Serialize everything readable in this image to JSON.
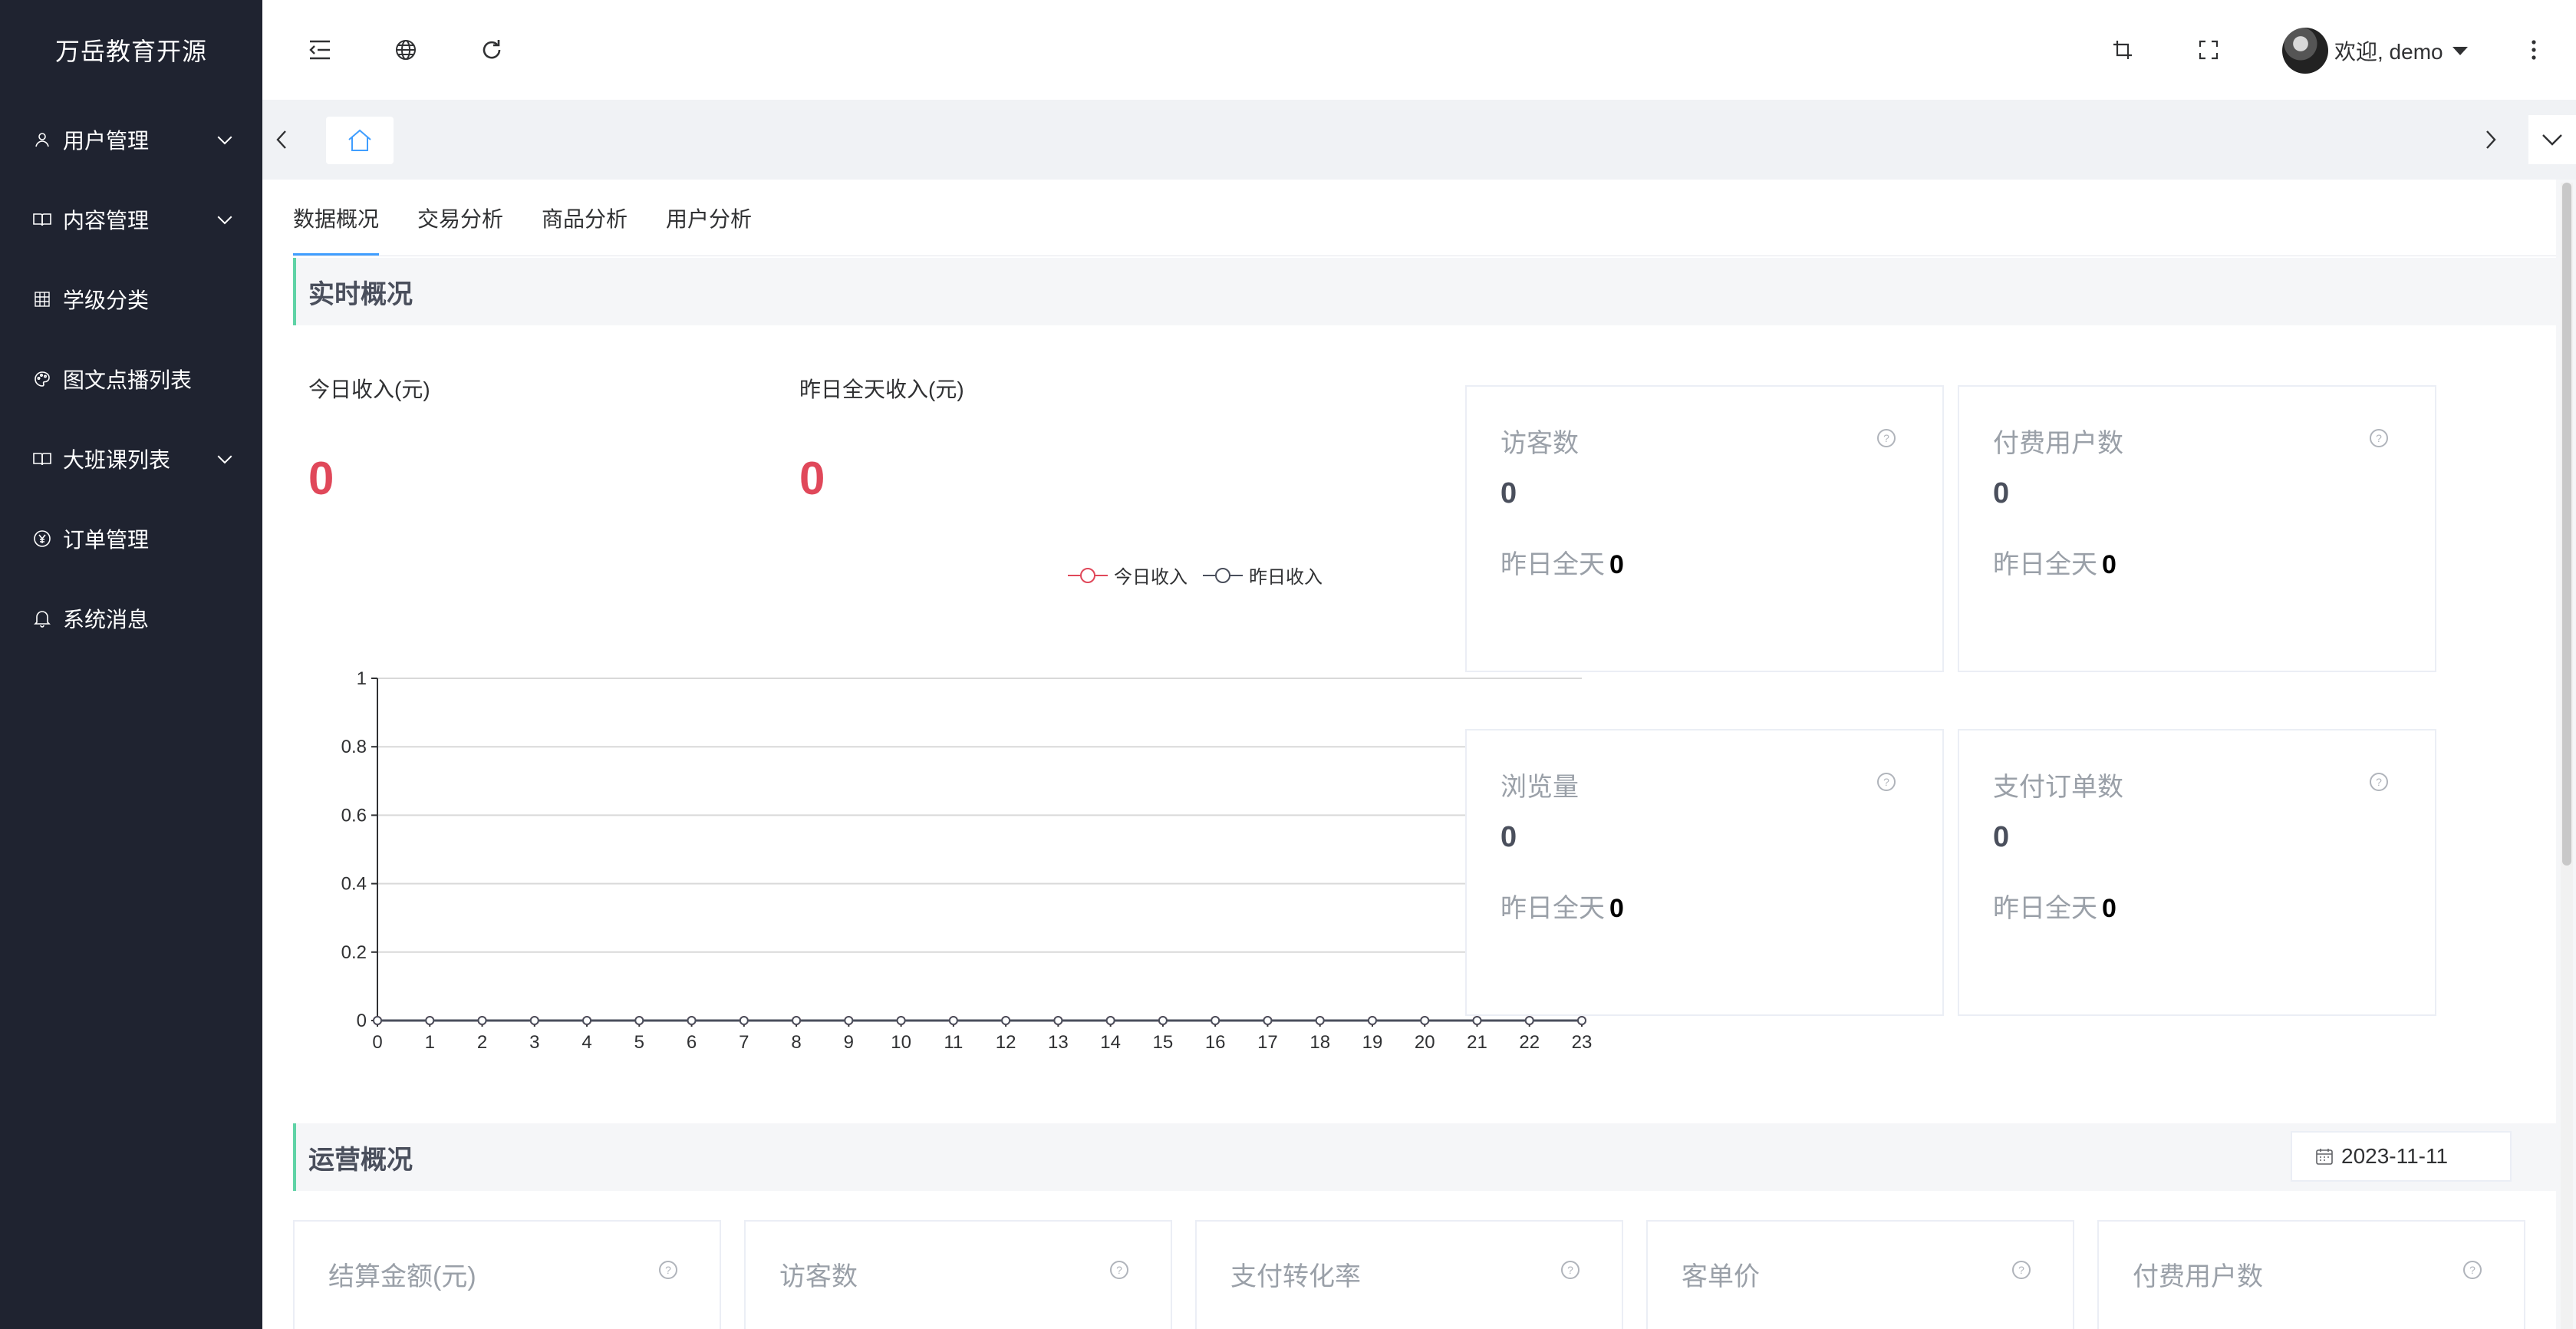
{
  "app": {
    "title": "万岳教育开源"
  },
  "sidebar": {
    "items": [
      {
        "label": "用户管理",
        "icon": "user-icon",
        "has_children": true
      },
      {
        "label": "内容管理",
        "icon": "book-icon",
        "has_children": true
      },
      {
        "label": "学级分类",
        "icon": "grid-icon",
        "has_children": false
      },
      {
        "label": "图文点播列表",
        "icon": "palette-icon",
        "has_children": false
      },
      {
        "label": "大班课列表",
        "icon": "book-icon",
        "has_children": true
      },
      {
        "label": "订单管理",
        "icon": "yen-icon",
        "has_children": false
      },
      {
        "label": "系统消息",
        "icon": "bell-icon",
        "has_children": false
      }
    ]
  },
  "header": {
    "icons": [
      "collapse-menu-icon",
      "globe-icon",
      "refresh-icon",
      "crop-icon",
      "fullscreen-icon",
      "more-vertical-icon"
    ],
    "user_name": "欢迎, demo"
  },
  "tabs": [
    {
      "label": "数据概况",
      "active": true
    },
    {
      "label": "交易分析",
      "active": false
    },
    {
      "label": "商品分析",
      "active": false
    },
    {
      "label": "用户分析",
      "active": false
    }
  ],
  "realtime": {
    "title": "实时概况",
    "today_label": "今日收入(元)",
    "today_value": "0",
    "yesterday_label": "昨日全天收入(元)",
    "yesterday_value": "0",
    "legend": [
      "今日收入",
      "昨日收入"
    ],
    "cards": [
      {
        "title": "访客数",
        "value": "0",
        "yest_label": "昨日全天",
        "yest_value": "0"
      },
      {
        "title": "付费用户数",
        "value": "0",
        "yest_label": "昨日全天",
        "yest_value": "0"
      },
      {
        "title": "浏览量",
        "value": "0",
        "yest_label": "昨日全天",
        "yest_value": "0"
      },
      {
        "title": "支付订单数",
        "value": "0",
        "yest_label": "昨日全天",
        "yest_value": "0"
      }
    ]
  },
  "operation": {
    "title": "运营概况",
    "date": "2023-11-11",
    "cards": [
      {
        "title": "结算金额(元)"
      },
      {
        "title": "访客数"
      },
      {
        "title": "支付转化率"
      },
      {
        "title": "客单价"
      },
      {
        "title": "付费用户数"
      }
    ]
  },
  "colors": {
    "sidebar_bg": "#1f2330",
    "accent": "#409eff",
    "revenue": "#e0485a",
    "section_border": "#5fd3a6",
    "today_series": "#e0485a",
    "yesterday_series": "#4a4f5c"
  },
  "chart_data": {
    "type": "line",
    "x": [
      "0",
      "1",
      "2",
      "3",
      "4",
      "5",
      "6",
      "7",
      "8",
      "9",
      "10",
      "11",
      "12",
      "13",
      "14",
      "15",
      "16",
      "17",
      "18",
      "19",
      "20",
      "21",
      "22",
      "23"
    ],
    "series": [
      {
        "name": "今日收入",
        "values": [
          0,
          0,
          0,
          0,
          0,
          0,
          0,
          0,
          0,
          0,
          0,
          0,
          0,
          0,
          0,
          0,
          0,
          0,
          0,
          0,
          0,
          0,
          0,
          0
        ]
      },
      {
        "name": "昨日收入",
        "values": [
          0,
          0,
          0,
          0,
          0,
          0,
          0,
          0,
          0,
          0,
          0,
          0,
          0,
          0,
          0,
          0,
          0,
          0,
          0,
          0,
          0,
          0,
          0,
          0
        ]
      }
    ],
    "ylim": [
      0,
      1
    ],
    "yticks": [
      "0",
      "0.2",
      "0.4",
      "0.6",
      "0.8",
      "1"
    ],
    "grid": true,
    "legend": "top-right"
  }
}
